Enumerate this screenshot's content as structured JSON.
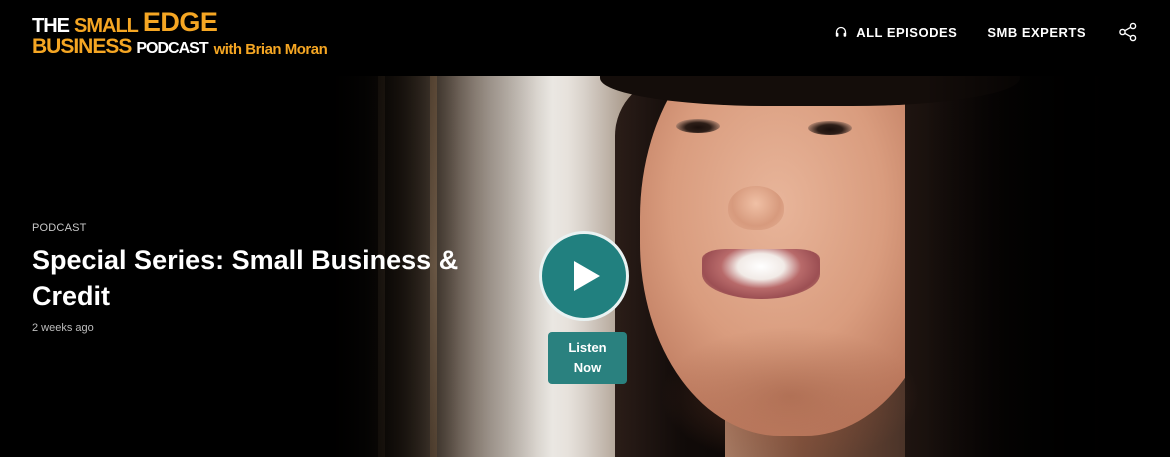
{
  "logo": {
    "the": "THE",
    "small": "SMALL",
    "edge": "EDGE",
    "business": "BUSINESS",
    "podcast": "PODCAST",
    "with": "with Brian Moran"
  },
  "nav": {
    "items": [
      {
        "label": "ALL EPISODES",
        "icon": "headphones-icon"
      },
      {
        "label": "SMB EXPERTS"
      }
    ],
    "share_icon": "share-icon"
  },
  "hero": {
    "category": "PODCAST",
    "title": "Special Series: Small Business & Credit",
    "time": "2 weeks ago",
    "play_icon": "play-icon",
    "listen_label": "Listen Now"
  },
  "colors": {
    "accent": "#f5a623",
    "teal": "#21807f",
    "background": "#000000"
  }
}
